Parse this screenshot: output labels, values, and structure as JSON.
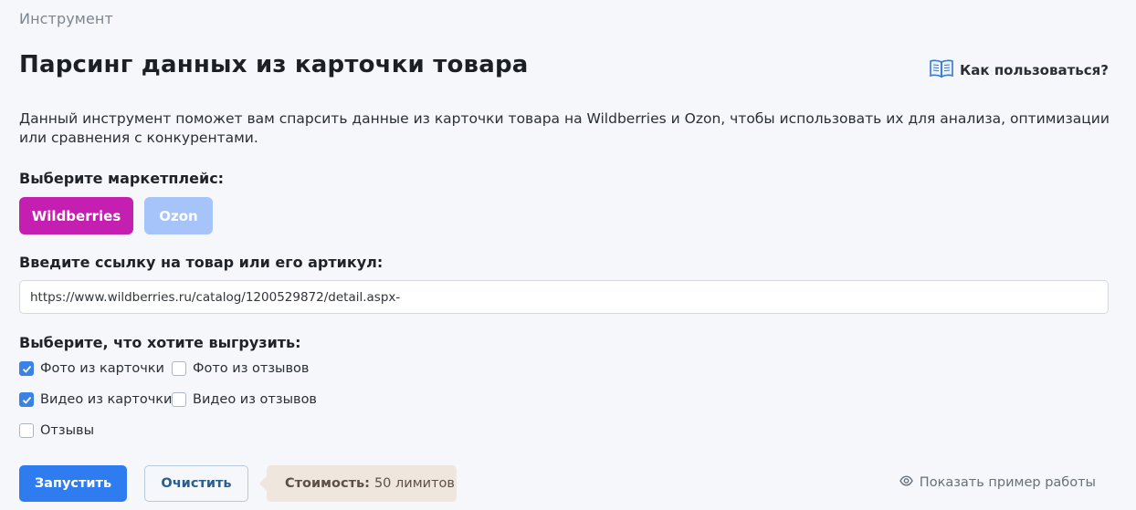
{
  "breadcrumb": "Инструмент",
  "page_title": "Парсинг данных из карточки товара",
  "help_link": {
    "label": "Как пользоваться?",
    "icon": "book-icon"
  },
  "description": "Данный инструмент поможет вам спарсить данные из карточки товара на Wildberries и Ozon, чтобы использовать их для анализа, оптимизации или сравнения с конкурентами.",
  "marketplace": {
    "label": "Выберите маркетплейс:",
    "options": [
      {
        "label": "Wildberries",
        "selected": true,
        "color": "#c41fb1"
      },
      {
        "label": "Ozon",
        "selected": false,
        "color": "#a6c4fa"
      }
    ]
  },
  "product": {
    "label": "Введите ссылку на товар или его артикул:",
    "value": "https://www.wildberries.ru/catalog/1200529872/detail.aspx-"
  },
  "export": {
    "label": "Выберите, что хотите выгрузить:",
    "options": [
      {
        "label": "Фото из карточки",
        "checked": true
      },
      {
        "label": "Фото из отзывов",
        "checked": false
      },
      {
        "label": "Видео из карточки",
        "checked": true
      },
      {
        "label": "Видео из отзывов",
        "checked": false
      },
      {
        "label": "Отзывы",
        "checked": false
      }
    ]
  },
  "actions": {
    "run_label": "Запустить",
    "clear_label": "Очистить",
    "cost_label": "Стоимость:",
    "cost_value": "50 лимитов",
    "example_label": "Показать пример работы"
  },
  "colors": {
    "accent": "#2f7cf0",
    "checkbox": "#3b82e8"
  }
}
